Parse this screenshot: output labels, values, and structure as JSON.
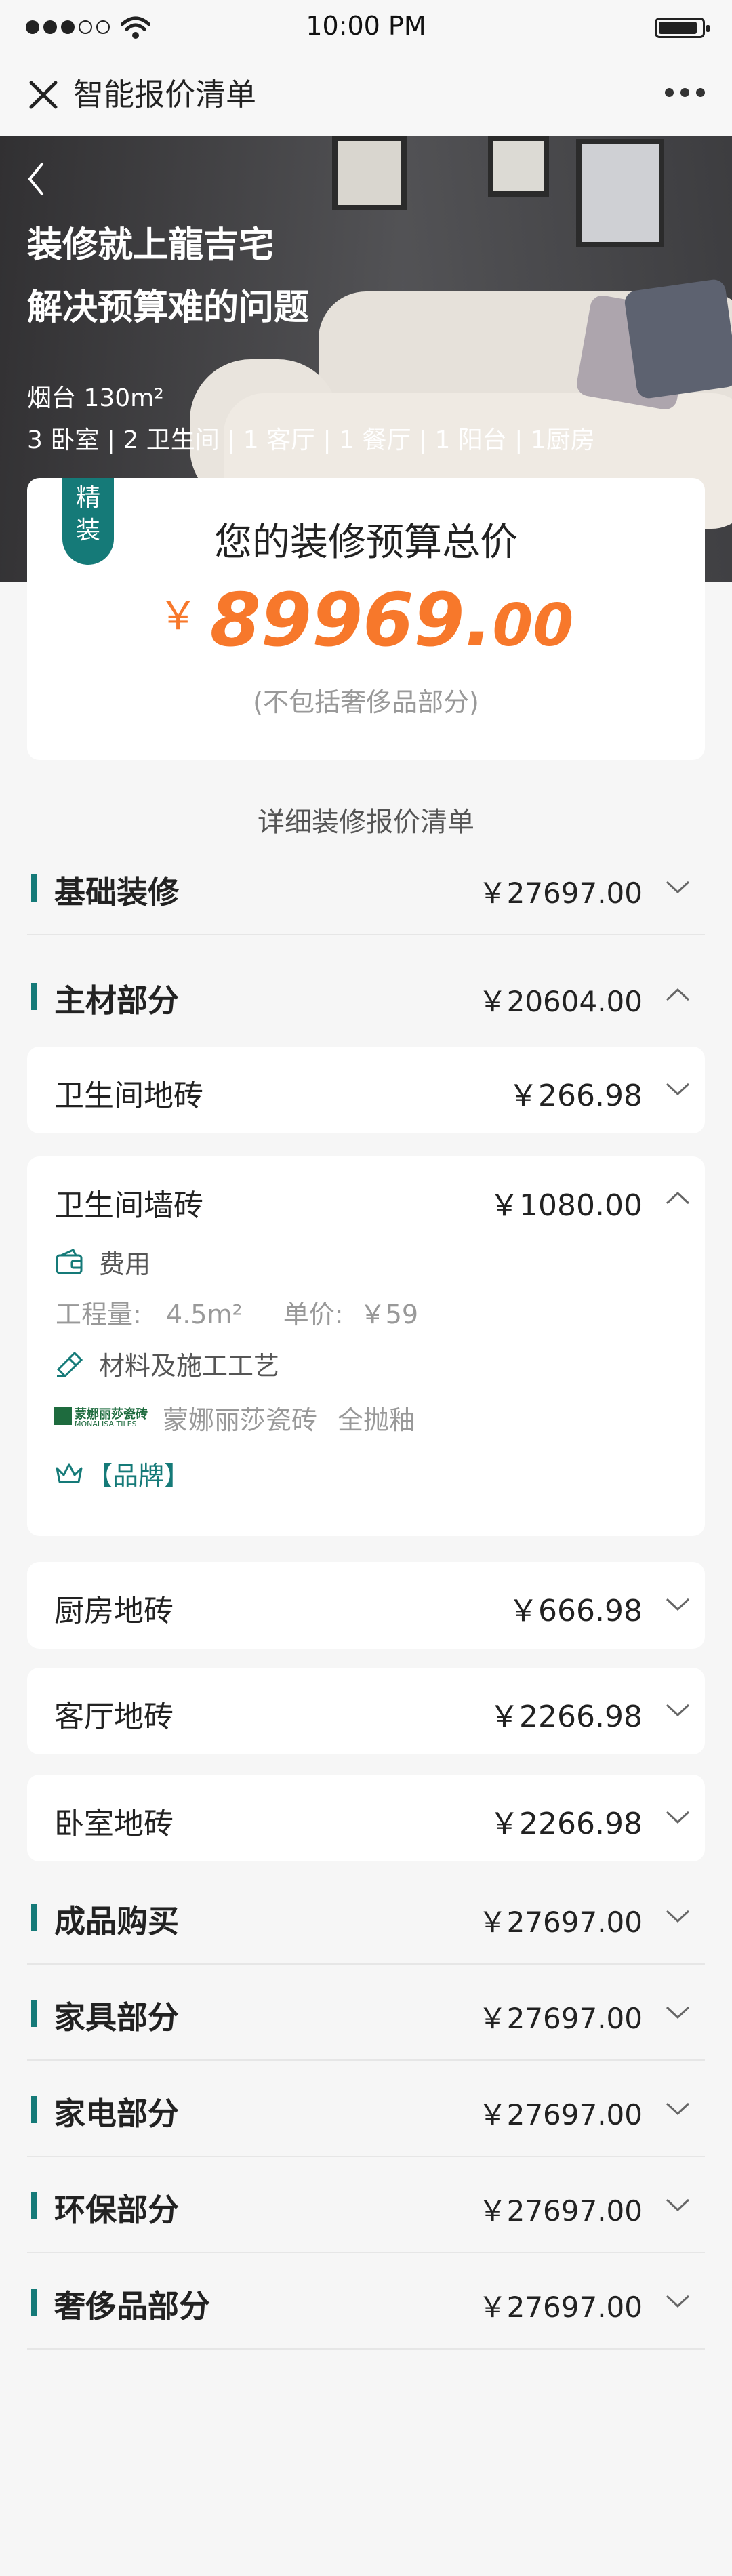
{
  "status_bar": {
    "time": "10:00 PM"
  },
  "nav": {
    "title": "智能报价清单"
  },
  "hero": {
    "line1": "装修就上龍吉宅",
    "line2": "解决预算难的问题",
    "area": "烟台  130m²",
    "rooms": "3 卧室 | 2 卫生间 | 1 客厅 | 1 餐厅 | 1 阳台  | 1厨房"
  },
  "budget": {
    "tag": "精装",
    "title": "您的装修预算总价",
    "currency": "￥",
    "price_int": "89969.",
    "price_dec": "00",
    "note": "(不包括奢侈品部分)"
  },
  "detail_heading": "详细装修报价清单",
  "sections": {
    "basic": {
      "name": "基础装修",
      "amount": "￥27697.00"
    },
    "main": {
      "name": "主材部分",
      "amount": "￥20604.00"
    },
    "finished": {
      "name": "成品购买",
      "amount": "￥27697.00"
    },
    "furniture": {
      "name": "家具部分",
      "amount": "￥27697.00"
    },
    "appliance": {
      "name": "家电部分",
      "amount": "￥27697.00"
    },
    "eco": {
      "name": "环保部分",
      "amount": "￥27697.00"
    },
    "luxury": {
      "name": "奢侈品部分",
      "amount": "￥27697.00"
    }
  },
  "items": {
    "bath_floor": {
      "name": "卫生间地砖",
      "amount": "￥266.98"
    },
    "bath_wall": {
      "name": "卫生间墙砖",
      "amount": "￥1080.00",
      "cost_label": "费用",
      "quantity": "工程量:   4.5m²",
      "unit_price": "单价:  ￥59",
      "craft_label": "材料及施工工艺",
      "brand_logo_cn": "蒙娜丽莎瓷砖",
      "brand_logo_en": "MONALISA TILES",
      "brand_name": "蒙娜丽莎瓷砖",
      "glaze": "全抛釉",
      "brand_tag": "【品牌】"
    },
    "kitchen_floor": {
      "name": "厨房地砖",
      "amount": "￥666.98"
    },
    "living_floor": {
      "name": "客厅地砖",
      "amount": "￥2266.98"
    },
    "bedroom_floor": {
      "name": "卧室地砖",
      "amount": "￥2266.98"
    }
  },
  "colors": {
    "accent": "#157a78",
    "price": "#f7782b"
  },
  "icons": [
    "close-icon",
    "more-icon",
    "back-icon",
    "chevron-down-icon",
    "chevron-up-icon",
    "wallet-icon",
    "roller-icon",
    "crown-icon"
  ]
}
